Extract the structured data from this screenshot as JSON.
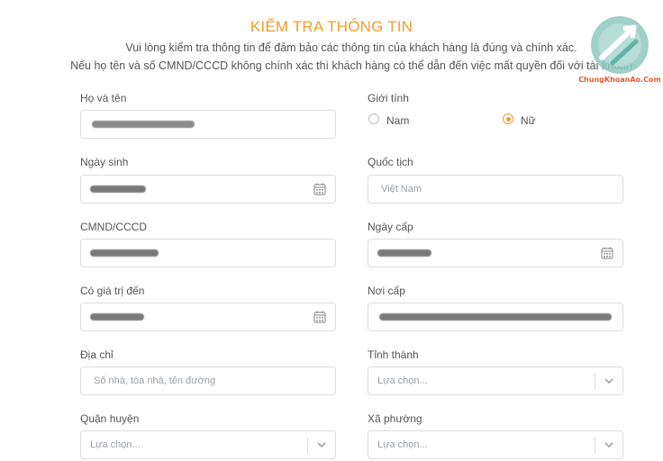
{
  "header": {
    "title": "KIỂM TRA THÔNG TIN",
    "line1": "Vui lòng kiểm tra thông tin để đảm bảo các thông tin của khách hàng là đúng và chính xác.",
    "line2": "Nếu họ tên và số CMND/CCCD không chính xác thì khách hàng có thể dẫn đến việc mất quyền đối với tài khoản"
  },
  "watermark": {
    "text": "ChungKhoanAo.Com"
  },
  "form": {
    "full_name": {
      "label": "Họ và tên",
      "value": ""
    },
    "gender": {
      "label": "Giới tính",
      "options": [
        "Nam",
        "Nữ"
      ],
      "selected": "Nữ"
    },
    "dob": {
      "label": "Ngày sinh",
      "value": ""
    },
    "nationality": {
      "label": "Quốc tịch",
      "placeholder": "Việt Nam"
    },
    "id_number": {
      "label": "CMND/CCCD",
      "value": ""
    },
    "issue_date": {
      "label": "Ngày cấp",
      "value": ""
    },
    "valid_until": {
      "label": "Có giá trị đến",
      "value": ""
    },
    "issue_place": {
      "label": "Nơi cấp",
      "value": ""
    },
    "address": {
      "label": "Địa chỉ",
      "placeholder": "Số nhà, tòa nhà, tên đường"
    },
    "province": {
      "label": "Tỉnh thành",
      "placeholder": "Lựa chọn..."
    },
    "district": {
      "label": "Quận huyện",
      "placeholder": "Lựa chọn..."
    },
    "ward": {
      "label": "Xã phường",
      "placeholder": "Lựa chọn..."
    }
  },
  "colors": {
    "accent": "#f39c2b",
    "border": "#dcdcdc",
    "placeholder": "#9aa0a6"
  }
}
